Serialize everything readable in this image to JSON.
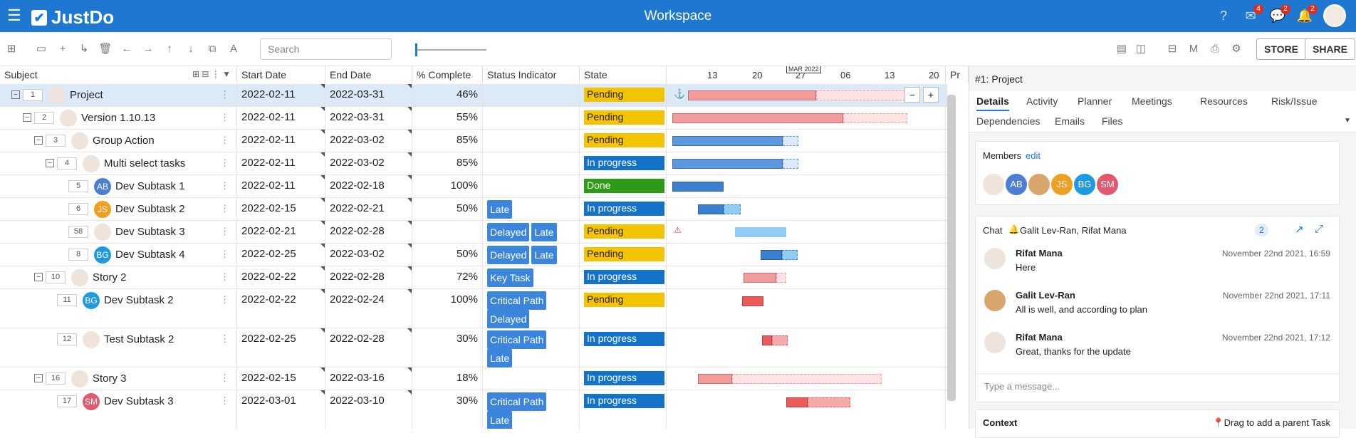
{
  "app": {
    "logo": "JustDo",
    "title": "Workspace",
    "badges": [
      "4",
      "2",
      "2"
    ]
  },
  "toolbar": {
    "search_placeholder": "Search",
    "store": "STORE",
    "share": "SHARE"
  },
  "columns": [
    "Subject",
    "Start Date",
    "End Date",
    "% Complete",
    "Status Indicator",
    "State"
  ],
  "gantt": {
    "month_label": "MAR 2022",
    "ticks": [
      "13",
      "20",
      "27",
      "06",
      "13",
      "20"
    ],
    "extra_col": "Pr"
  },
  "rows": [
    {
      "num": "1",
      "subject": "Project",
      "start": "2022-02-11",
      "end": "2022-03-31",
      "pct": "46%",
      "status": [],
      "state": "Pending"
    },
    {
      "num": "2",
      "subject": "Version 1.10.13",
      "start": "2022-02-11",
      "end": "2022-03-31",
      "pct": "55%",
      "status": [],
      "state": "Pending"
    },
    {
      "num": "3",
      "subject": "Group Action",
      "start": "2022-02-11",
      "end": "2022-03-02",
      "pct": "85%",
      "status": [],
      "state": "Pending"
    },
    {
      "num": "4",
      "subject": "Multi select tasks",
      "start": "2022-02-11",
      "end": "2022-03-02",
      "pct": "85%",
      "status": [],
      "state": "In progress"
    },
    {
      "num": "5",
      "subject": "Dev Subtask 1",
      "start": "2022-02-11",
      "end": "2022-02-18",
      "pct": "100%",
      "status": [],
      "state": "Done",
      "avatar": "AB"
    },
    {
      "num": "6",
      "subject": "Dev Subtask 2",
      "start": "2022-02-15",
      "end": "2022-02-21",
      "pct": "50%",
      "status": [
        "Late"
      ],
      "state": "In progress",
      "avatar": "JS"
    },
    {
      "num": "58",
      "subject": "Dev Subtask 3",
      "start": "2022-02-21",
      "end": "2022-02-28",
      "pct": "",
      "status": [
        "Delayed",
        "Late"
      ],
      "state": "Pending"
    },
    {
      "num": "8",
      "subject": "Dev Subtask 4",
      "start": "2022-02-25",
      "end": "2022-03-02",
      "pct": "50%",
      "status": [
        "Delayed",
        "Late"
      ],
      "state": "Pending",
      "avatar": "BG"
    },
    {
      "num": "10",
      "subject": "Story 2",
      "start": "2022-02-22",
      "end": "2022-02-28",
      "pct": "72%",
      "status": [
        "Key Task"
      ],
      "state": "In progress"
    },
    {
      "num": "11",
      "subject": "Dev Subtask 2",
      "start": "2022-02-22",
      "end": "2022-02-24",
      "pct": "100%",
      "status": [
        "Critical Path",
        "Delayed"
      ],
      "state": "Pending",
      "avatar": "BG"
    },
    {
      "num": "12",
      "subject": "Test Subtask 2",
      "start": "2022-02-25",
      "end": "2022-02-28",
      "pct": "30%",
      "status": [
        "Critical Path",
        "Late"
      ],
      "state": "In progress"
    },
    {
      "num": "16",
      "subject": "Story 3",
      "start": "2022-02-15",
      "end": "2022-03-16",
      "pct": "18%",
      "status": [],
      "state": "In progress"
    },
    {
      "num": "17",
      "subject": "Dev Subtask 3",
      "start": "2022-03-01",
      "end": "2022-03-10",
      "pct": "30%",
      "status": [
        "Critical Path",
        "Late"
      ],
      "state": "In progress",
      "avatar": "SM"
    }
  ],
  "panel": {
    "title": "#1: Project",
    "tabs": [
      "Details",
      "Activity",
      "Planner",
      "Meetings",
      "Resources",
      "Risk/Issue",
      "Dependencies",
      "Emails",
      "Files"
    ],
    "members_label": "Members",
    "edit": "edit",
    "member_initials": [
      "AB",
      "JS",
      "BG",
      "SM"
    ],
    "chat_title": "Chat",
    "chat_people": "Galit Lev-Ran, Rifat Mana",
    "chat_count": "2",
    "messages": [
      {
        "name": "Rifat Mana",
        "time": "November 22nd 2021, 16:59",
        "text": "Here"
      },
      {
        "name": "Galit Lev-Ran",
        "time": "November 22nd 2021, 17:11",
        "text": "All is well, and according to plan"
      },
      {
        "name": "Rifat Mana",
        "time": "November 22nd 2021, 17:12",
        "text": "Great, thanks for the update"
      }
    ],
    "message_placeholder": "Type a message...",
    "context_label": "Context",
    "context_hint": "Drag to add a parent Task"
  }
}
